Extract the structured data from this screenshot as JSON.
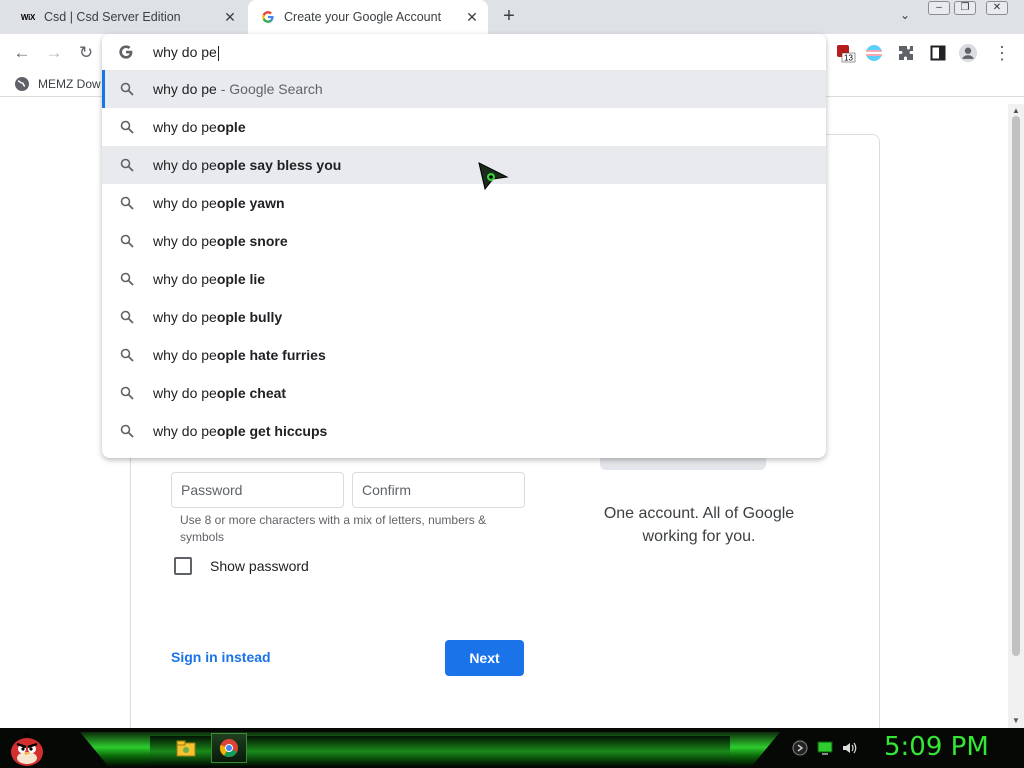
{
  "tabs": [
    {
      "favicon": "WiX",
      "title": "Csd | Csd Server Edition"
    },
    {
      "favicon": "google-g",
      "title": "Create your Google Account"
    }
  ],
  "toolbar": {
    "extension_badge": "13"
  },
  "bookmarks": [
    {
      "label": "MEMZ Dow"
    }
  ],
  "omnibox": {
    "typed": "why do pe"
  },
  "suggestions": [
    {
      "typed": "why do pe",
      "completion": "",
      "desc": " - Google Search",
      "state": "selected"
    },
    {
      "typed": "why do pe",
      "completion": "ople",
      "desc": "",
      "state": ""
    },
    {
      "typed": "why do pe",
      "completion": "ople say bless you",
      "desc": "",
      "state": "hover"
    },
    {
      "typed": "why do pe",
      "completion": "ople yawn",
      "desc": "",
      "state": ""
    },
    {
      "typed": "why do pe",
      "completion": "ople snore",
      "desc": "",
      "state": ""
    },
    {
      "typed": "why do pe",
      "completion": "ople lie",
      "desc": "",
      "state": ""
    },
    {
      "typed": "why do pe",
      "completion": "ople bully",
      "desc": "",
      "state": ""
    },
    {
      "typed": "why do pe",
      "completion": "ople hate furries",
      "desc": "",
      "state": ""
    },
    {
      "typed": "why do pe",
      "completion": "ople cheat",
      "desc": "",
      "state": ""
    },
    {
      "typed": "why do pe",
      "completion": "ople get hiccups",
      "desc": "",
      "state": ""
    }
  ],
  "form": {
    "password_placeholder": "Password",
    "confirm_placeholder": "Confirm",
    "password_hint": "Use 8 or more characters with a mix of letters, numbers & symbols",
    "show_password_label": "Show password",
    "sign_in_label": "Sign in instead",
    "next_label": "Next"
  },
  "promo": {
    "tagline": "One account. All of Google working for you."
  },
  "taskbar": {
    "clock": "5:09 PM"
  },
  "colors": {
    "accent": "#1a73e8",
    "clock": "#36e636",
    "selected_row": "#e8eaed"
  }
}
